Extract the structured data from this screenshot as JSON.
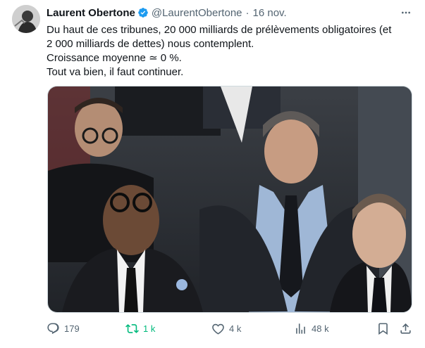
{
  "author": {
    "name": "Laurent Obertone",
    "handle": "@LaurentObertone",
    "date": "16 nov."
  },
  "tweet": {
    "lines": [
      "Du haut de ces tribunes, 20 000 milliards de prélèvements obligatoires (et",
      "2 000 milliards de dettes) nous contemplent.",
      "Croissance moyenne ≃ 0 %.",
      "Tout va bien, il faut continuer."
    ]
  },
  "actions": {
    "replies": "179",
    "retweets": "1 k",
    "likes": "4 k",
    "views": "48 k"
  },
  "colors": {
    "text": "#0f1419",
    "muted": "#536471",
    "verified": "#1d9bf0",
    "retweet": "#00ba7c"
  },
  "icons": [
    "verified-badge-icon",
    "more-icon",
    "reply-icon",
    "retweet-icon",
    "like-icon",
    "views-icon",
    "bookmark-icon",
    "share-icon"
  ]
}
